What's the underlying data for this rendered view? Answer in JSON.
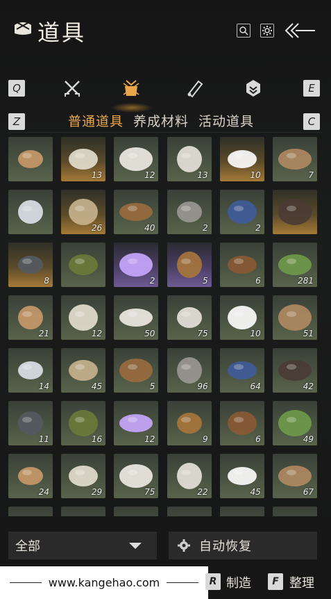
{
  "header": {
    "title": "道具",
    "title_icon": "bundle-icon",
    "search_icon": "search-icon",
    "settings_icon": "gear-icon",
    "back_icon": "back-arrow-icon"
  },
  "categories": {
    "prev_key": "Q",
    "next_key": "E",
    "icons": [
      "crossed-swords-icon",
      "pouch-icon",
      "scroll-icon",
      "token-icon"
    ],
    "active_index": 1
  },
  "tabs": {
    "prev_key": "Z",
    "next_key": "C",
    "items": [
      "普通道具",
      "养成材料",
      "活动道具"
    ],
    "active_index": 0
  },
  "items": [
    {
      "name": "flatbread-icon",
      "qty": "",
      "tint": "g"
    },
    {
      "name": "porcelain-cup-icon",
      "qty": "13",
      "tint": "o"
    },
    {
      "name": "porcelain-bowl-lid-icon",
      "qty": "12",
      "tint": "g"
    },
    {
      "name": "porcelain-plate-icon",
      "qty": "13",
      "tint": "g"
    },
    {
      "name": "white-bowl-icon",
      "qty": "10",
      "tint": "o"
    },
    {
      "name": "wooden-plank-icon",
      "qty": "7",
      "tint": "g"
    },
    {
      "name": "white-orb-icon",
      "qty": "",
      "tint": "g"
    },
    {
      "name": "cloth-map-icon",
      "qty": "26",
      "tint": "o"
    },
    {
      "name": "arrows-icon",
      "qty": "40",
      "tint": "g"
    },
    {
      "name": "stone-tablet-icon",
      "qty": "2",
      "tint": "g"
    },
    {
      "name": "blue-flower-icon",
      "qty": "2",
      "tint": "g"
    },
    {
      "name": "rat-icon",
      "qty": "",
      "tint": "o"
    },
    {
      "name": "ore-icon",
      "qty": "8",
      "tint": "o"
    },
    {
      "name": "cricket-icon",
      "qty": "",
      "tint": "g"
    },
    {
      "name": "sea-urchin-icon",
      "qty": "2",
      "tint": "p"
    },
    {
      "name": "wheel-icon",
      "qty": "5",
      "tint": "p"
    },
    {
      "name": "log-bundle-icon",
      "qty": "6",
      "tint": "g"
    },
    {
      "name": "bamboo-bundle-icon",
      "qty": "281",
      "tint": "g"
    },
    {
      "name": "log-pile-icon",
      "qty": "21",
      "tint": "g"
    },
    {
      "name": "log-pile-icon",
      "qty": "12",
      "tint": "g"
    },
    {
      "name": "log-pile-icon",
      "qty": "50",
      "tint": "g"
    },
    {
      "name": "log-pile-icon",
      "qty": "75",
      "tint": "g"
    },
    {
      "name": "log-pile-icon",
      "qty": "10",
      "tint": "g"
    },
    {
      "name": "feather-icon",
      "qty": "51",
      "tint": "g"
    },
    {
      "name": "mushroom-slices-icon",
      "qty": "14",
      "tint": "g"
    },
    {
      "name": "insect-icon",
      "qty": "45",
      "tint": "g"
    },
    {
      "name": "berries-icon",
      "qty": "5",
      "tint": "g"
    },
    {
      "name": "mushrooms-icon",
      "qty": "96",
      "tint": "g"
    },
    {
      "name": "eggs-icon",
      "qty": "64",
      "tint": "g"
    },
    {
      "name": "raw-meat-icon",
      "qty": "42",
      "tint": "g"
    },
    {
      "name": "feathers-icon",
      "qty": "11",
      "tint": "g"
    },
    {
      "name": "hide-icon",
      "qty": "16",
      "tint": "g"
    },
    {
      "name": "intestines-icon",
      "qty": "12",
      "tint": "g"
    },
    {
      "name": "meat-slab-icon",
      "qty": "9",
      "tint": "g"
    },
    {
      "name": "fish-icon",
      "qty": "6",
      "tint": "g"
    },
    {
      "name": "gold-ore-icon",
      "qty": "49",
      "tint": "g"
    },
    {
      "name": "amethyst-icon",
      "qty": "24",
      "tint": "g"
    },
    {
      "name": "red-gem-icon",
      "qty": "29",
      "tint": "g"
    },
    {
      "name": "herb-icon",
      "qty": "75",
      "tint": "g"
    },
    {
      "name": "mortar-icon",
      "qty": "22",
      "tint": "g"
    },
    {
      "name": "purple-flower-icon",
      "qty": "45",
      "tint": "g"
    },
    {
      "name": "lavender-icon",
      "qty": "67",
      "tint": "g"
    }
  ],
  "filter": {
    "label": "全部",
    "caret_icon": "caret-down-icon"
  },
  "auto_restore": {
    "label": "自动恢复",
    "icon": "gear-icon"
  },
  "footer": {
    "watermark": "www.kangehao.com",
    "craft_key": "R",
    "craft_label": "制造",
    "sort_key": "F",
    "sort_label": "整理"
  },
  "colors": {
    "accent": "#e7a64b",
    "cell_common": "#4a5342",
    "cell_rare": "#a57a36",
    "cell_epic": "#6e5a94"
  }
}
